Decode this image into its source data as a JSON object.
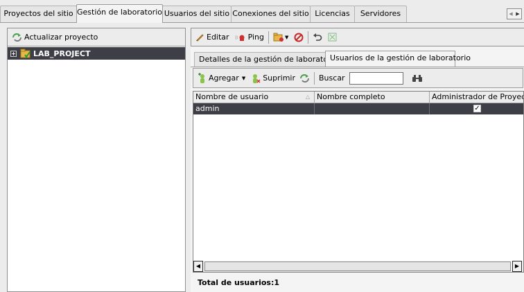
{
  "top_tabs": [
    {
      "label": "Proyectos del sitio",
      "active": false
    },
    {
      "label": "Gestión de laboratorio",
      "active": true
    },
    {
      "label": "Usuarios del sitio",
      "active": false
    },
    {
      "label": "Conexiones del sitio",
      "active": false
    },
    {
      "label": "Licencias",
      "active": false
    },
    {
      "label": "Servidores",
      "active": false
    }
  ],
  "left_panel": {
    "refresh_label": "Actualizar proyecto",
    "tree": [
      {
        "label": "LAB_PROJECT",
        "selected": true,
        "expander": "+"
      }
    ]
  },
  "right_toolbar": {
    "edit_label": "Editar",
    "ping_label": "Ping"
  },
  "sub_tabs": [
    {
      "label": "Detalles de la gestión de laboratorio",
      "active": false
    },
    {
      "label": "Usuarios de la gestión de laboratorio",
      "active": true
    }
  ],
  "user_toolbar": {
    "add_label": "Agregar",
    "delete_label": "Suprimir",
    "search_label": "Buscar",
    "search_value": ""
  },
  "grid": {
    "columns": [
      "Nombre de usuario",
      "Nombre completo",
      "Administrador de Proyecto"
    ],
    "rows": [
      {
        "username": "admin",
        "full_name": "",
        "is_admin": true
      }
    ]
  },
  "footer": {
    "total_label": "Total de usuarios:",
    "total_count": "1"
  },
  "colors": {
    "selection": "#3e3e46",
    "background": "#ececec"
  }
}
